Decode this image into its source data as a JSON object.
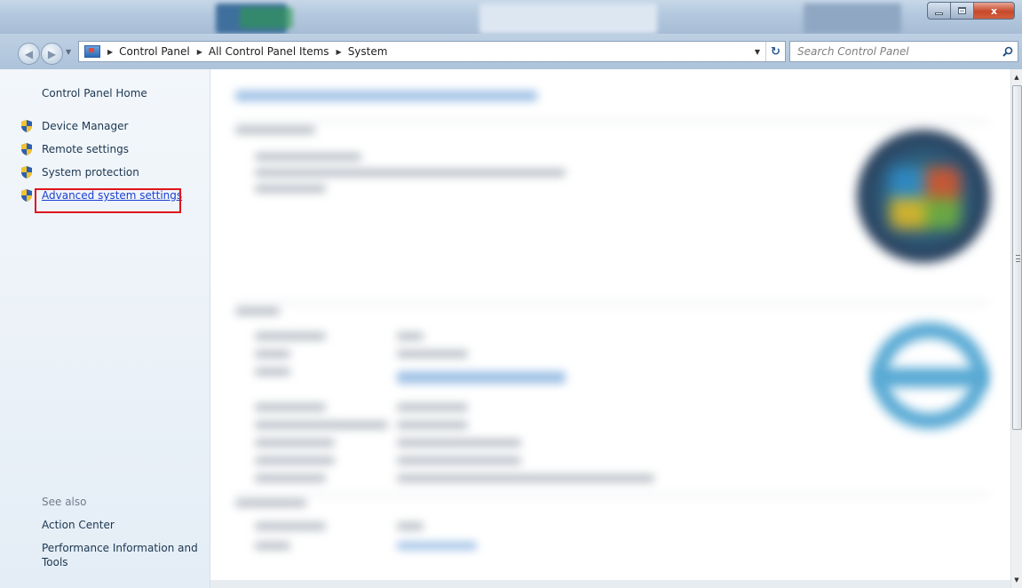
{
  "window": {
    "controls": {
      "minimize": "–",
      "maximize": "□",
      "close": "x"
    }
  },
  "address_bar": {
    "crumbs": [
      "Control Panel",
      "All Control Panel Items",
      "System"
    ],
    "refresh_icon": "refresh-icon"
  },
  "search": {
    "placeholder": "Search Control Panel"
  },
  "left_pane": {
    "home_link": "Control Panel Home",
    "tasks": [
      {
        "label": "Device Manager",
        "icon": "uac-shield-icon"
      },
      {
        "label": "Remote settings",
        "icon": "uac-shield-icon"
      },
      {
        "label": "System protection",
        "icon": "uac-shield-icon"
      },
      {
        "label": "Advanced system settings",
        "icon": "uac-shield-icon",
        "highlighted": true
      }
    ],
    "see_also": {
      "heading": "See also",
      "links": [
        "Action Center",
        "Performance Information and Tools"
      ]
    }
  },
  "colors": {
    "highlight_box": "#e0141c",
    "link_hover": "#1a3fd1",
    "text_link": "#1b3650"
  }
}
